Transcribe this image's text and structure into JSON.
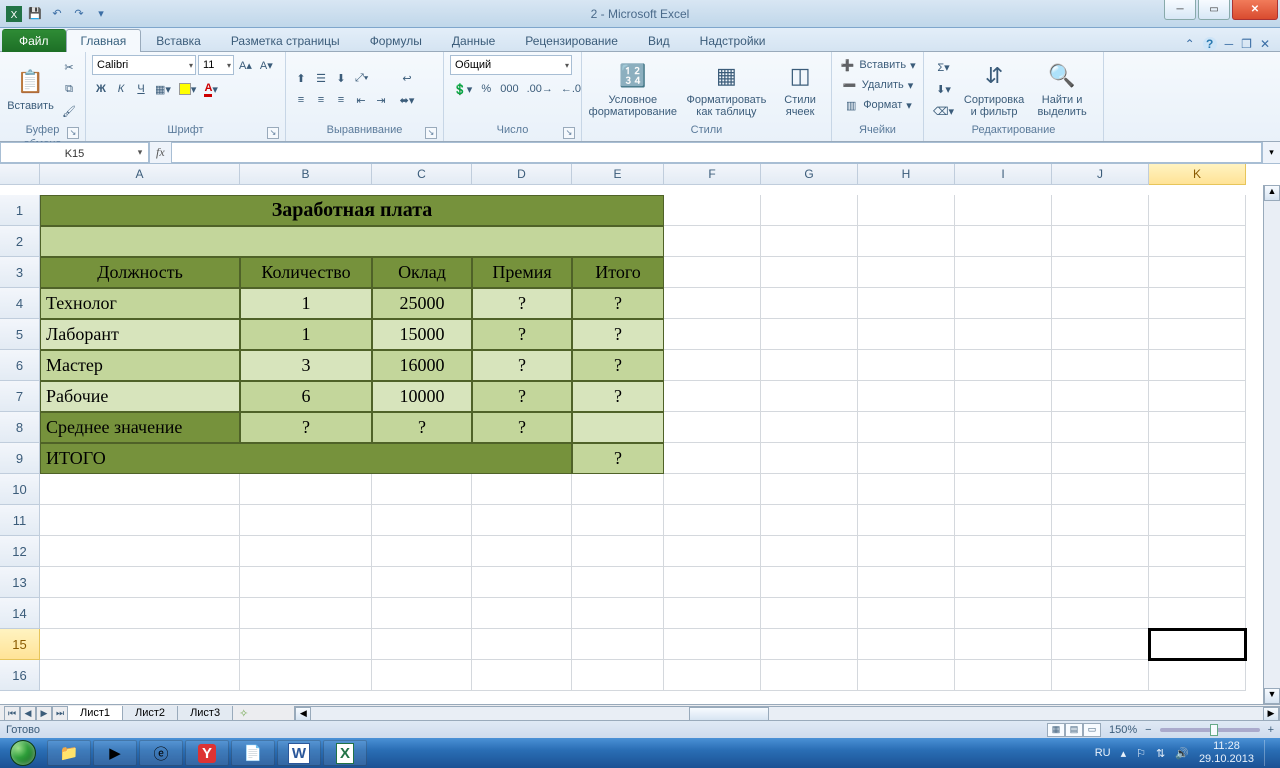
{
  "window": {
    "title": "2 - Microsoft Excel"
  },
  "qat": {
    "save": "💾",
    "undo": "↶",
    "redo": "↷"
  },
  "tabs": {
    "file": "Файл",
    "items": [
      "Главная",
      "Вставка",
      "Разметка страницы",
      "Формулы",
      "Данные",
      "Рецензирование",
      "Вид",
      "Надстройки"
    ],
    "active": 0
  },
  "ribbon": {
    "clipboard": {
      "paste": "Вставить",
      "label": "Буфер обмена"
    },
    "font": {
      "name": "Calibri",
      "size": "11",
      "label": "Шрифт",
      "bold": "Ж",
      "italic": "К",
      "underline": "Ч"
    },
    "align": {
      "label": "Выравнивание",
      "wrap": "",
      "merge": ""
    },
    "number": {
      "format": "Общий",
      "label": "Число"
    },
    "styles": {
      "cond": "Условное форматирование",
      "table": "Форматировать как таблицу",
      "cell": "Стили ячеек",
      "label": "Стили"
    },
    "cells": {
      "insert": "Вставить",
      "delete": "Удалить",
      "format": "Формат",
      "label": "Ячейки"
    },
    "editing": {
      "sort": "Сортировка и фильтр",
      "find": "Найти и выделить",
      "label": "Редактирование"
    }
  },
  "namebox": "K15",
  "columns": [
    "A",
    "B",
    "C",
    "D",
    "E",
    "F",
    "G",
    "H",
    "I",
    "J",
    "K"
  ],
  "colw": {
    "A": 200,
    "B": 132,
    "C": 100,
    "D": 100,
    "E": 92
  },
  "rows": 16,
  "selected": {
    "row": 15,
    "col": "K"
  },
  "data": {
    "title": "Заработная плата",
    "headers": [
      "Должность",
      "Количество",
      "Оклад",
      "Премия",
      "Итого"
    ],
    "rows": [
      {
        "name": "Технолог",
        "qty": "1",
        "salary": "25000",
        "bonus": "?",
        "total": "?"
      },
      {
        "name": "Лаборант",
        "qty": "1",
        "salary": "15000",
        "bonus": "?",
        "total": "?"
      },
      {
        "name": "Мастер",
        "qty": "3",
        "salary": "16000",
        "bonus": "?",
        "total": "?"
      },
      {
        "name": "Рабочие",
        "qty": "6",
        "salary": "10000",
        "bonus": "?",
        "total": "?"
      }
    ],
    "avg": {
      "label": "Среднее значение",
      "qty": "?",
      "salary": "?",
      "bonus": "?"
    },
    "grand": {
      "label": "ИТОГО",
      "total": "?"
    }
  },
  "sheets": {
    "items": [
      "Лист1",
      "Лист2",
      "Лист3"
    ],
    "active": 0
  },
  "status": {
    "ready": "Готово",
    "zoom": "150%"
  },
  "tray": {
    "lang": "RU",
    "time": "11:28",
    "date": "29.10.2013"
  }
}
